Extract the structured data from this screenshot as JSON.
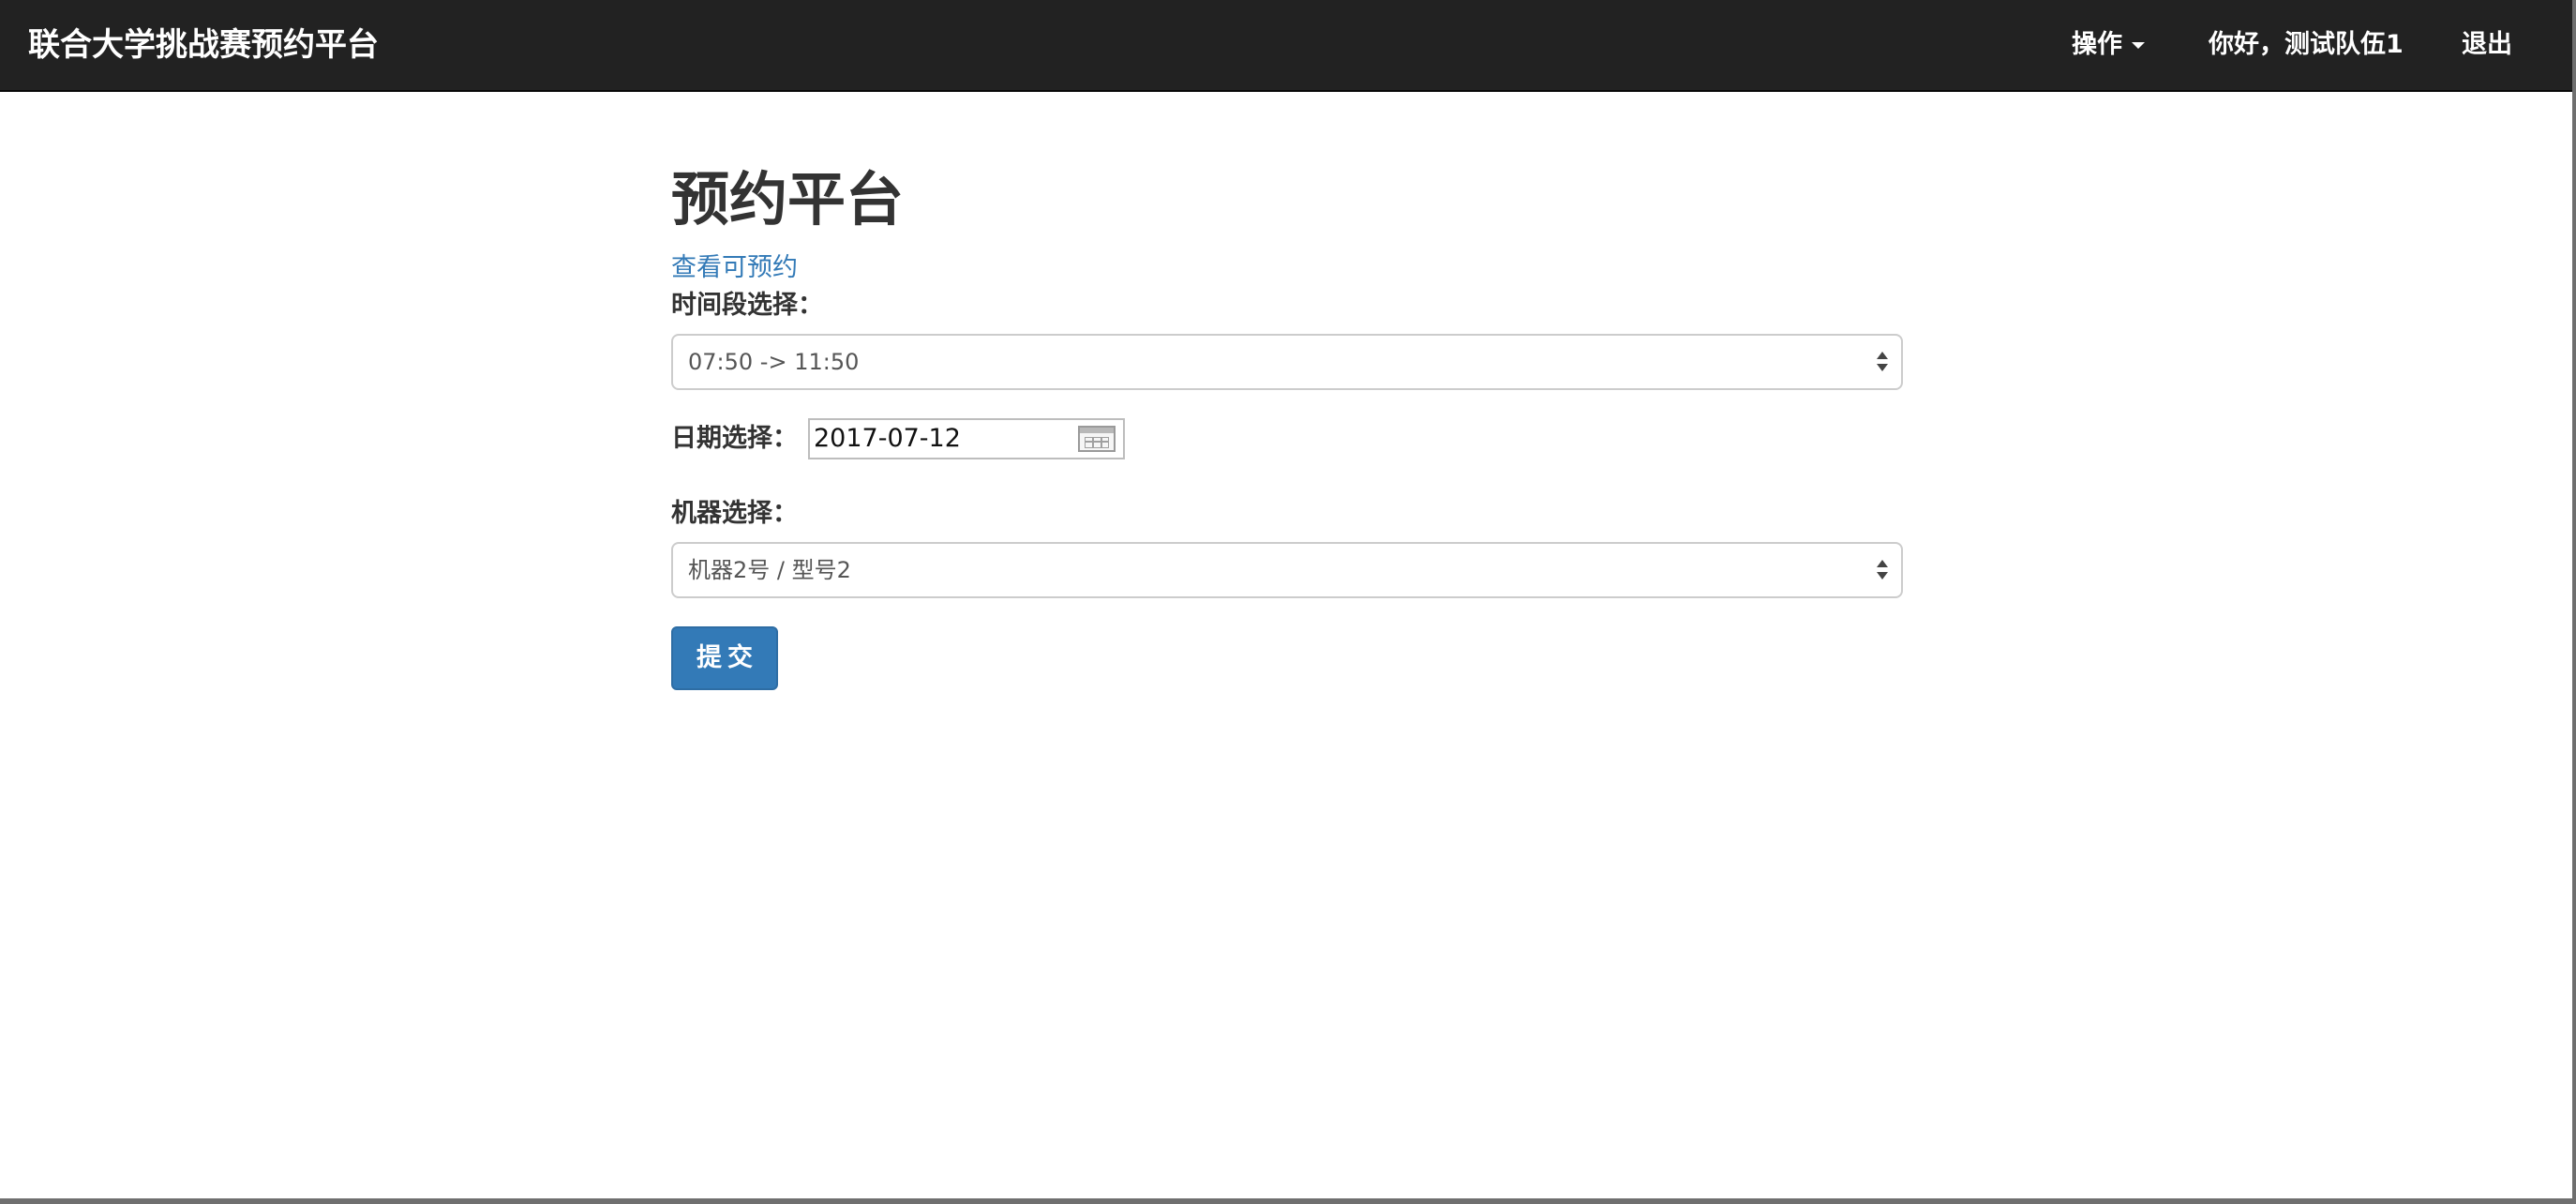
{
  "navbar": {
    "brand": "联合大学挑战赛预约平台",
    "operations": "操作",
    "greeting": "你好，测试队伍1",
    "logout": "退出"
  },
  "main": {
    "title": "预约平台",
    "view_available_link": "查看可预约",
    "time_label": "时间段选择：",
    "time_value": "07:50 -> 11:50",
    "date_label": "日期选择：",
    "date_value": "2017-07-12",
    "machine_label": "机器选择：",
    "machine_value": "机器2号 / 型号2",
    "submit_label": "提交"
  },
  "colors": {
    "navbar_bg": "#222222",
    "link": "#337ab7",
    "primary_button": "#337ab7"
  }
}
